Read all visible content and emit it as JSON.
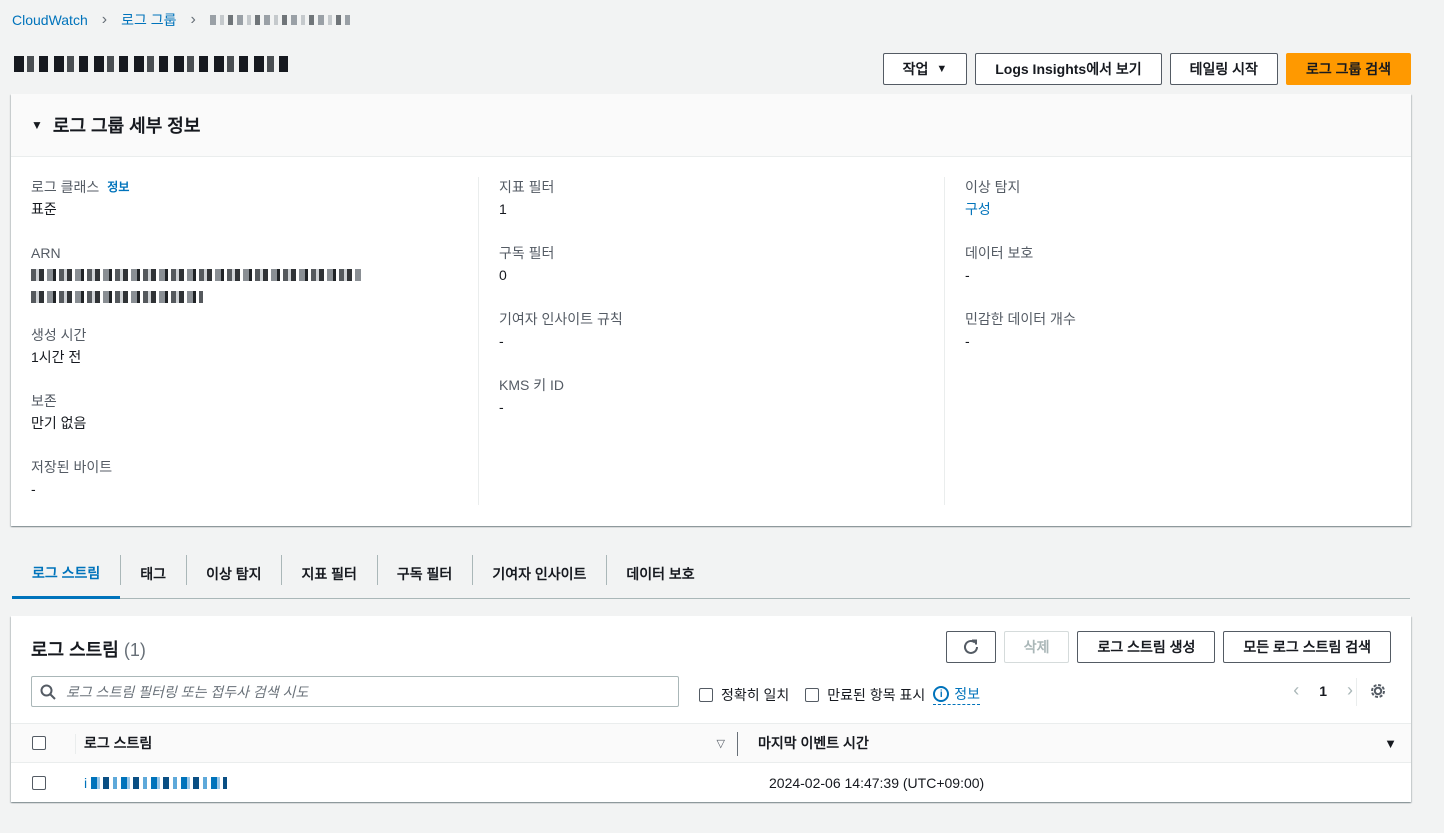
{
  "breadcrumb": {
    "root": "CloudWatch",
    "log_groups": "로그 그룹"
  },
  "header": {
    "actions_label": "작업",
    "insights_label": "Logs Insights에서 보기",
    "tail_label": "테일링 시작",
    "search_label": "로그 그룹 검색"
  },
  "details": {
    "title": "로그 그룹 세부 정보",
    "log_class_label": "로그 클래스",
    "info_label": "정보",
    "log_class_value": "표준",
    "arn_label": "ARN",
    "created_label": "생성 시간",
    "created_value": "1시간 전",
    "retention_label": "보존",
    "retention_value": "만기 없음",
    "stored_bytes_label": "저장된 바이트",
    "stored_bytes_value": "-",
    "metric_filters_label": "지표 필터",
    "metric_filters_value": "1",
    "subscription_filters_label": "구독 필터",
    "subscription_filters_value": "0",
    "contributor_rules_label": "기여자 인사이트 규칙",
    "contributor_rules_value": "-",
    "kms_label": "KMS 키 ID",
    "kms_value": "-",
    "anomaly_label": "이상 탐지",
    "anomaly_value": "구성",
    "data_protection_label": "데이터 보호",
    "data_protection_value": "-",
    "sensitive_count_label": "민감한 데이터 개수",
    "sensitive_count_value": "-"
  },
  "tabs": [
    {
      "label": "로그 스트림",
      "active": true
    },
    {
      "label": "태그",
      "active": false
    },
    {
      "label": "이상 탐지",
      "active": false
    },
    {
      "label": "지표 필터",
      "active": false
    },
    {
      "label": "구독 필터",
      "active": false
    },
    {
      "label": "기여자 인사이트",
      "active": false
    },
    {
      "label": "데이터 보호",
      "active": false
    }
  ],
  "streams": {
    "title": "로그 스트림",
    "count": "(1)",
    "delete_label": "삭제",
    "create_label": "로그 스트림 생성",
    "search_all_label": "모든 로그 스트림 검색",
    "search_placeholder": "로그 스트림 필터링 또는 접두사 검색 시도",
    "exact_match_label": "정확히 일치",
    "show_expired_label": "만료된 항목 표시",
    "info_label": "정보",
    "page": "1",
    "col_name": "로그 스트림",
    "col_time": "마지막 이벤트 시간",
    "rows": [
      {
        "name_prefix": "i",
        "last_event": "2024-02-06 14:47:39 (UTC+09:00)"
      }
    ]
  },
  "icons": {
    "refresh": "refresh-icon",
    "search": "search-icon",
    "settings": "gear-icon",
    "info": "info-icon"
  },
  "colors": {
    "primary": "#ff9900",
    "link": "#0073bb",
    "background": "#f2f3f3"
  }
}
